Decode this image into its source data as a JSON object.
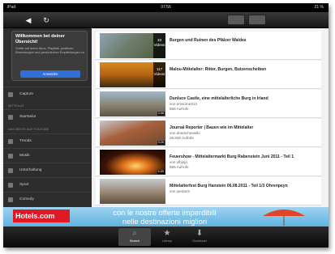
{
  "status": {
    "carrier": "iPad",
    "time": "07:56",
    "battery": "21 %"
  },
  "toolbar": {
    "back_icon": "◀",
    "reload_icon": "↻"
  },
  "sidebar": {
    "welcome_title": "Willkommen bei deiner Übersicht!",
    "welcome_body": "Greife auf deine Abos, Playlists, positiven Bewertungen und persönlichen Empfehlungen zu.",
    "signin_label": "Anmelden",
    "capture_label": "Capture",
    "section_mine": "Mitteilat",
    "startseite_label": "Startseite",
    "section_best": "Das Beste auf YouTube",
    "items": [
      {
        "label": "Trends"
      },
      {
        "label": "Musik"
      },
      {
        "label": "Unterhaltung"
      },
      {
        "label": "Sport"
      },
      {
        "label": "Comedy"
      }
    ]
  },
  "videos": [
    {
      "title": "Burgen und Ruinen des Pfälzer Waldes",
      "badge_count": "33",
      "badge_unit": "Videos",
      "author": "",
      "views": "",
      "duration": ""
    },
    {
      "title": "Malou-Mittelalter: Ritter, Burgen, Butzenscheiben",
      "badge_count": "117",
      "badge_unit": "Videos",
      "author": "",
      "views": "",
      "duration": ""
    },
    {
      "title": "Dunluce Castle, eine mittelalterliche Burg in Irland",
      "badge_count": "",
      "badge_unit": "",
      "author": "von emsome314",
      "views": "856 Aufrufe",
      "duration": "3:38"
    },
    {
      "title": "Journal Reporter | Bauen wie im Mittelalter",
      "badge_count": "",
      "badge_unit": "",
      "author": "von deutschewelle",
      "views": "25.600 Aufrufe",
      "duration": "5:26"
    },
    {
      "title": "Feuershow - Mittelaltermarkt Burg Rabenstein Juni 2011 - Teil 1",
      "badge_count": "",
      "badge_unit": "",
      "author": "von vfbjojo",
      "views": "555 Aufrufe",
      "duration": "6:55"
    },
    {
      "title": "Mittelalterfest Burg Hanstein 06.08.2011 - Teil 1/3 Ohrenpeyn",
      "badge_count": "",
      "badge_unit": "",
      "author": "von juedarm",
      "views": "",
      "duration": ""
    }
  ],
  "ad": {
    "logo": "Hotels.com",
    "line1": "con le nostre offerte imperdibili",
    "line2": "nelle destinazioni migliori"
  },
  "tabs": [
    {
      "label": "Search",
      "icon": "⌕"
    },
    {
      "label": "Library",
      "icon": "★"
    },
    {
      "label": "Download",
      "icon": "⬇"
    }
  ],
  "colors": {
    "accent": "#2f6fd6",
    "ad_bg": "#7cc3ea",
    "ad_logo": "#e01a24"
  }
}
